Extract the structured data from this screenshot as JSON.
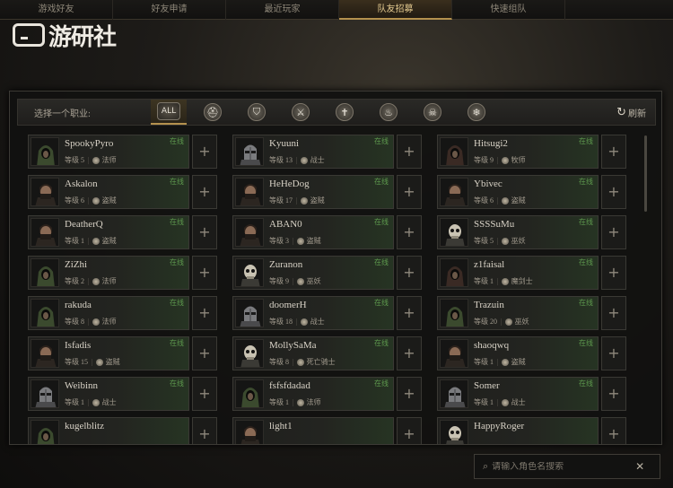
{
  "tabs": [
    {
      "label": "游戏好友",
      "active": false
    },
    {
      "label": "好友申请",
      "active": false
    },
    {
      "label": "最近玩家",
      "active": false
    },
    {
      "label": "队友招募",
      "active": true
    },
    {
      "label": "快速组队",
      "active": false
    }
  ],
  "watermark": {
    "text": "游研社"
  },
  "filter": {
    "label": "选择一个职业:",
    "classes": [
      {
        "label": "ALL",
        "icon": "all-icon",
        "active": true
      },
      {
        "label": "",
        "icon": "helmet-icon"
      },
      {
        "label": "",
        "icon": "shield-icon"
      },
      {
        "label": "",
        "icon": "crossed-swords-icon"
      },
      {
        "label": "",
        "icon": "cross-icon"
      },
      {
        "label": "",
        "icon": "flame-icon"
      },
      {
        "label": "",
        "icon": "skull-icon"
      },
      {
        "label": "",
        "icon": "snowflake-icon"
      }
    ],
    "refresh_label": "刷新"
  },
  "players": [
    {
      "name": "SpookyPyro",
      "status": "在线",
      "level_text": "等级 5",
      "class": "法师",
      "avatar": "hood"
    },
    {
      "name": "Kyuuni",
      "status": "在线",
      "level_text": "等级 13",
      "class": "战士",
      "avatar": "helm"
    },
    {
      "name": "Hitsugi2",
      "status": "在线",
      "level_text": "等级 9",
      "class": "牧师",
      "avatar": "hood-red"
    },
    {
      "name": "Askalon",
      "status": "在线",
      "level_text": "等级 6",
      "class": "盗贼",
      "avatar": "rogue"
    },
    {
      "name": "HeHeDog",
      "status": "在线",
      "level_text": "等级 17",
      "class": "盗贼",
      "avatar": "rogue"
    },
    {
      "name": "Ybivec",
      "status": "在线",
      "level_text": "等级 6",
      "class": "盗贼",
      "avatar": "rogue"
    },
    {
      "name": "DeatherQ",
      "status": "在线",
      "level_text": "等级 1",
      "class": "盗贼",
      "avatar": "rogue"
    },
    {
      "name": "ABAN0",
      "status": "在线",
      "level_text": "等级 3",
      "class": "盗贼",
      "avatar": "rogue"
    },
    {
      "name": "SSSSuMu",
      "status": "在线",
      "level_text": "等级 5",
      "class": "巫妖",
      "avatar": "skull"
    },
    {
      "name": "ZiZhi",
      "status": "在线",
      "level_text": "等级 2",
      "class": "法师",
      "avatar": "hood"
    },
    {
      "name": "Zuranon",
      "status": "在线",
      "level_text": "等级 9",
      "class": "巫妖",
      "avatar": "skull"
    },
    {
      "name": "z1faisal",
      "status": "在线",
      "level_text": "等级 1",
      "class": "魔剑士",
      "avatar": "hood-red"
    },
    {
      "name": "rakuda",
      "status": "在线",
      "level_text": "等级 8",
      "class": "法师",
      "avatar": "hood"
    },
    {
      "name": "doomerH",
      "status": "在线",
      "level_text": "等级 18",
      "class": "战士",
      "avatar": "helm"
    },
    {
      "name": "Trazuin",
      "status": "在线",
      "level_text": "等级 20",
      "class": "巫妖",
      "avatar": "hood"
    },
    {
      "name": "Isfadis",
      "status": "在线",
      "level_text": "等级 15",
      "class": "盗贼",
      "avatar": "rogue"
    },
    {
      "name": "MollySaMa",
      "status": "在线",
      "level_text": "等级 8",
      "class": "死亡骑士",
      "avatar": "skull"
    },
    {
      "name": "shaoqwq",
      "status": "在线",
      "level_text": "等级 1",
      "class": "盗贼",
      "avatar": "rogue"
    },
    {
      "name": "Weibinn",
      "status": "在线",
      "level_text": "等级 1",
      "class": "战士",
      "avatar": "helm"
    },
    {
      "name": "fsfsfdadad",
      "status": "在线",
      "level_text": "等级 1",
      "class": "法师",
      "avatar": "hood"
    },
    {
      "name": "Somer",
      "status": "在线",
      "level_text": "等级 1",
      "class": "战士",
      "avatar": "helm"
    },
    {
      "name": "kugelblitz",
      "status": "",
      "level_text": "",
      "class": "",
      "avatar": "hood"
    },
    {
      "name": "light1",
      "status": "",
      "level_text": "",
      "class": "",
      "avatar": "rogue"
    },
    {
      "name": "HappyRoger",
      "status": "",
      "level_text": "",
      "class": "",
      "avatar": "skull"
    }
  ],
  "add_label": "+",
  "search": {
    "placeholder": "请输入角色名搜索"
  },
  "colors": {
    "accent": "#b4914e",
    "online": "#5e9a4e",
    "panel": "#121211"
  }
}
